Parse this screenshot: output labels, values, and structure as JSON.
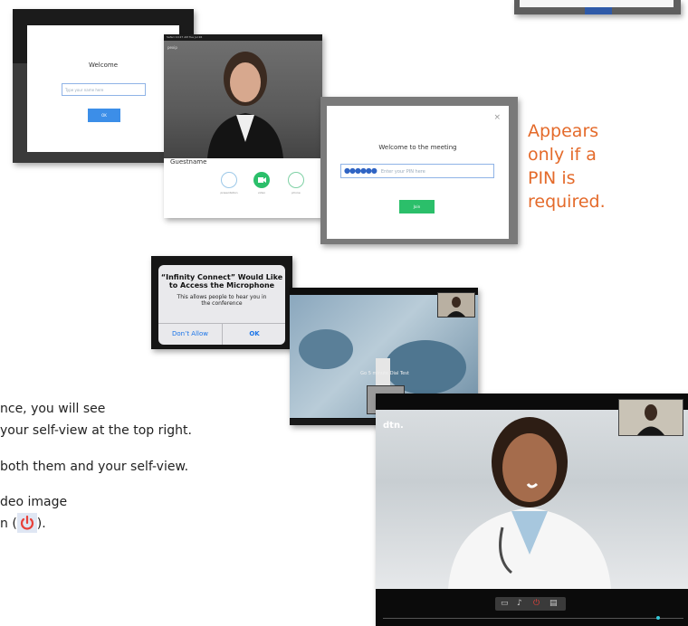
{
  "welcome_dialog": {
    "title": "Welcome",
    "name_placeholder": "Type your name here",
    "ok_label": "OK"
  },
  "call_screen": {
    "status_bar": "Safari 10:27 AM Tue Jul 26",
    "video_tag": "pexip",
    "guest_name": "Guestname",
    "button_labels": [
      "presentation",
      "video",
      "phone"
    ]
  },
  "pin_dialog": {
    "title": "Welcome to the meeting",
    "pin_dots": "●●●●●●",
    "pin_placeholder": "Enter your PIN here",
    "join_label": "Join",
    "close_glyph": "×"
  },
  "pin_note": [
    "Appears",
    "only if a",
    "PIN is",
    "required."
  ],
  "mic_alert": {
    "title_line1": "“Infinity Connect” Would Like",
    "title_line2": "to Access the Microphone",
    "message_line1": "This allows people to hear you in",
    "message_line2": "the conference",
    "deny_label": "Don’t Allow",
    "allow_label": "OK"
  },
  "conference_mid": {
    "caption": "Go 5 minute Dial Test"
  },
  "conference_big": {
    "logo": "dtn."
  },
  "instructions": {
    "line1": "nce, you will see",
    "line2": "your self-view at the top right.",
    "line3": "both them and your self-view.",
    "line4": "deo image",
    "line5_a": "n (",
    "line5_b": ")."
  },
  "colors": {
    "accent_orange": "#e46a2a",
    "join_green": "#2bbf6a",
    "ok_blue": "#3c8ee8",
    "power_red": "#e8413a"
  }
}
